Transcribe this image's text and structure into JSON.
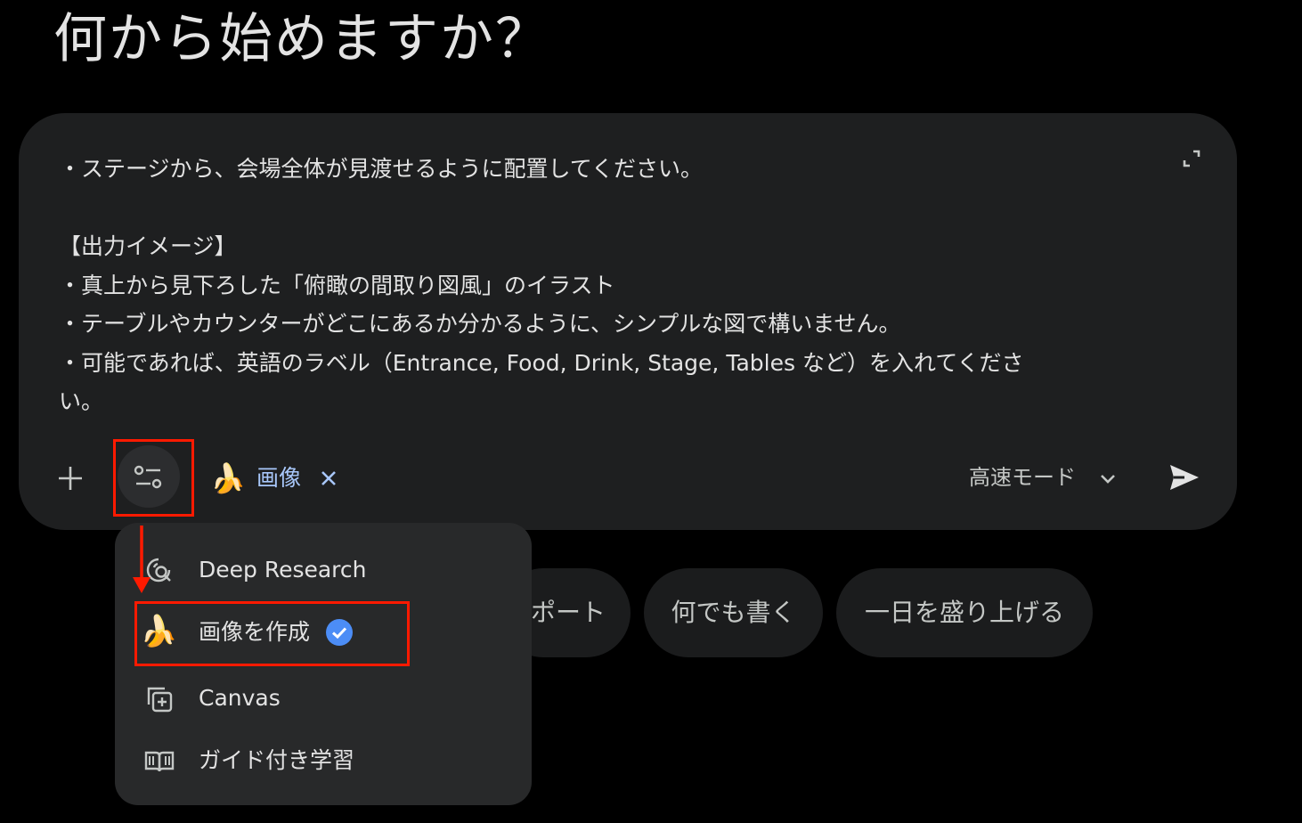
{
  "greeting": "何から始めますか？",
  "composer": {
    "prompt_lines": [
      "・ステージから、会場全体が見渡せるように配置してください。",
      "",
      "【出力イメージ】",
      "・真上から見下ろした「俯瞰の間取り図風」のイラスト",
      "・テーブルやカウンターがどこにあるか分かるように、シンプルな図で構いません。",
      "・可能であれば、英語のラベル（Entrance, Food, Drink, Stage, Tables など）を入れてくださ",
      "い。"
    ],
    "active_tool": {
      "emoji": "🍌",
      "label": "画像"
    },
    "mode_label": "高速モード"
  },
  "suggestions": [
    {
      "label": "ポート"
    },
    {
      "label": "何でも書く"
    },
    {
      "label": "一日を盛り上げる"
    }
  ],
  "tools_menu": {
    "items": [
      {
        "label": "Deep Research",
        "icon": "deep-research-icon"
      },
      {
        "label": "画像を作成",
        "icon": "banana",
        "emoji": "🍌",
        "selected": true
      },
      {
        "label": "Canvas",
        "icon": "canvas-icon"
      },
      {
        "label": "ガイド付き学習",
        "icon": "book-icon"
      }
    ]
  },
  "colors": {
    "background": "#000000",
    "composer": "#1e1f20",
    "menu": "#28292a",
    "accent": "#a8c7fa",
    "check": "#4c8df6",
    "highlight": "#ff1a00"
  }
}
